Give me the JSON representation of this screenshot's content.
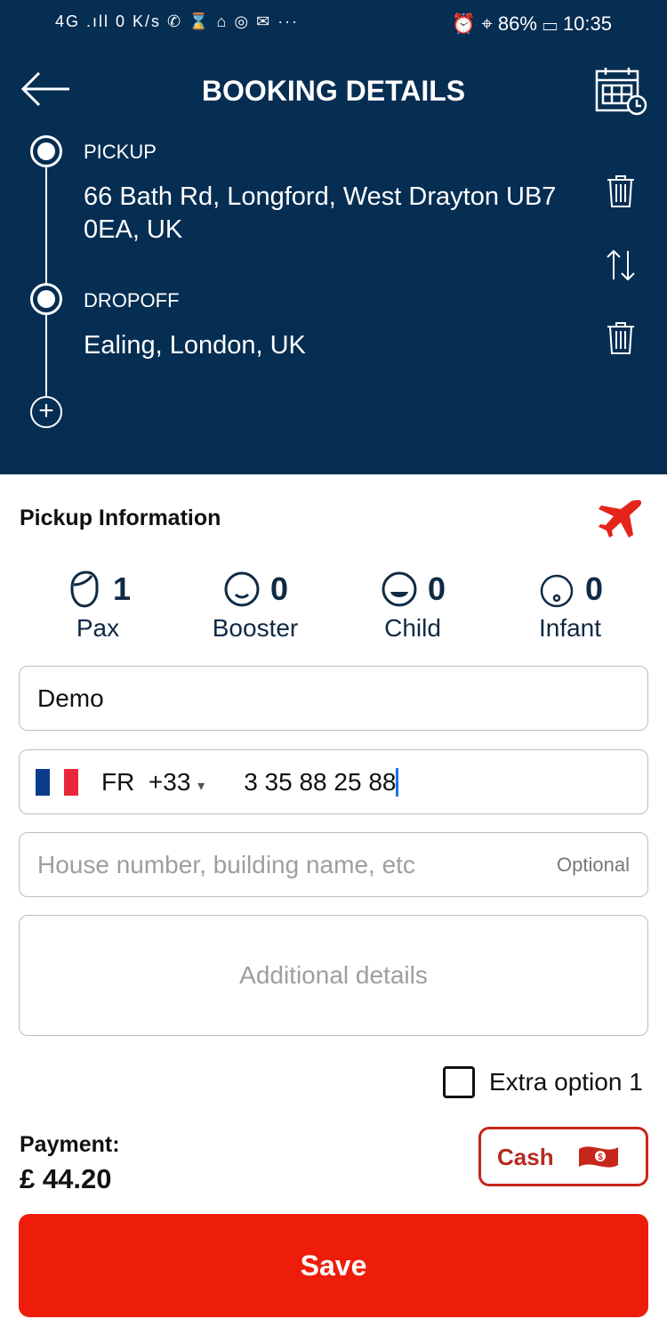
{
  "status_bar": {
    "left": "4G .ıll  0 K/s  ✆ ⌛ ⌂ ◎ ✉ ···",
    "battery": "86%",
    "time": "10:35"
  },
  "header": {
    "title": "BOOKING DETAILS"
  },
  "route": {
    "pickup_label": "PICKUP",
    "pickup_address": "66 Bath Rd, Longford, West Drayton UB7 0EA, UK",
    "dropoff_label": "DROPOFF",
    "dropoff_address": "Ealing, London, UK"
  },
  "pickup_info": {
    "title": "Pickup Information",
    "counters": [
      {
        "label": "Pax",
        "value": "1"
      },
      {
        "label": "Booster",
        "value": "0"
      },
      {
        "label": "Child",
        "value": "0"
      },
      {
        "label": "Infant",
        "value": "0"
      }
    ]
  },
  "form": {
    "name": "Demo",
    "country": "FR",
    "dial_code": "+33",
    "phone": "3 35 88 25 88",
    "house_placeholder": "House number, building name, etc",
    "house_optional": "Optional",
    "details_placeholder": "Additional details",
    "extra_option": "Extra option 1"
  },
  "payment": {
    "label": "Payment:",
    "amount": "£ 44.20",
    "method": "Cash"
  },
  "save_label": "Save",
  "colors": {
    "header": "#062d52",
    "accent": "#ee1c0a"
  }
}
